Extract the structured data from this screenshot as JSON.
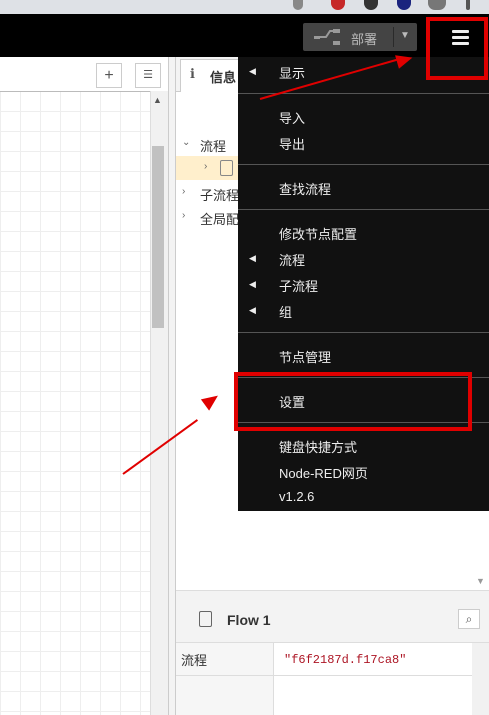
{
  "header": {
    "deploy_label": "部署"
  },
  "sidebar": {
    "tab_label": "信息",
    "tree": [
      {
        "label": "流程",
        "expanded": true
      },
      {
        "label": "",
        "selected": true
      },
      {
        "label": "子流程"
      },
      {
        "label": "全局配"
      }
    ]
  },
  "help": {
    "title": "Flow 1",
    "prop_key": "流程",
    "prop_value": "\"f6f2187d.f17ca8\""
  },
  "menu": {
    "items": [
      {
        "label": "显示",
        "submenu": true
      },
      {
        "label": "导入"
      },
      {
        "label": "导出"
      },
      {
        "label": "查找流程"
      },
      {
        "label": "修改节点配置"
      },
      {
        "label": "流程",
        "submenu": true
      },
      {
        "label": "子流程",
        "submenu": true
      },
      {
        "label": "组",
        "submenu": true
      },
      {
        "label": "节点管理"
      },
      {
        "label": "设置"
      },
      {
        "label": "键盘快捷方式"
      },
      {
        "label": "Node-RED网页"
      },
      {
        "label": "v1.2.6"
      }
    ]
  },
  "colors": {
    "annotation": "#e00000",
    "header_bg": "#000000",
    "menu_bg": "#111111"
  }
}
